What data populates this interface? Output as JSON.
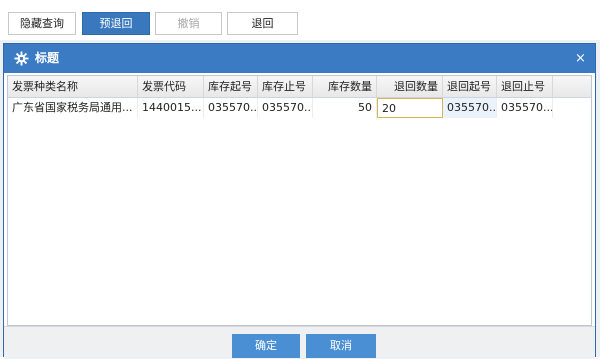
{
  "toolbar": {
    "buttons": [
      {
        "label": "隐藏查询"
      },
      {
        "label": "预退回"
      },
      {
        "label": "撤销"
      },
      {
        "label": "退回"
      }
    ]
  },
  "dialog": {
    "title": "标题",
    "close_symbol": "×",
    "columns": [
      "发票种类名称",
      "发票代码",
      "库存起号",
      "库存止号",
      "库存数量",
      "退回数量",
      "退回起号",
      "退回止号"
    ],
    "rows": [
      [
        "广东省国家税务局通用...",
        "1440015...",
        "035570...",
        "035570...",
        "50",
        "20",
        "035570...",
        "035570..."
      ]
    ],
    "confirm_label": "确定",
    "cancel_label": "取消"
  },
  "colors": {
    "accent": "#3b7bc4",
    "button_blue": "#4a8fd4",
    "toolbar_active": "#3a78bd"
  }
}
